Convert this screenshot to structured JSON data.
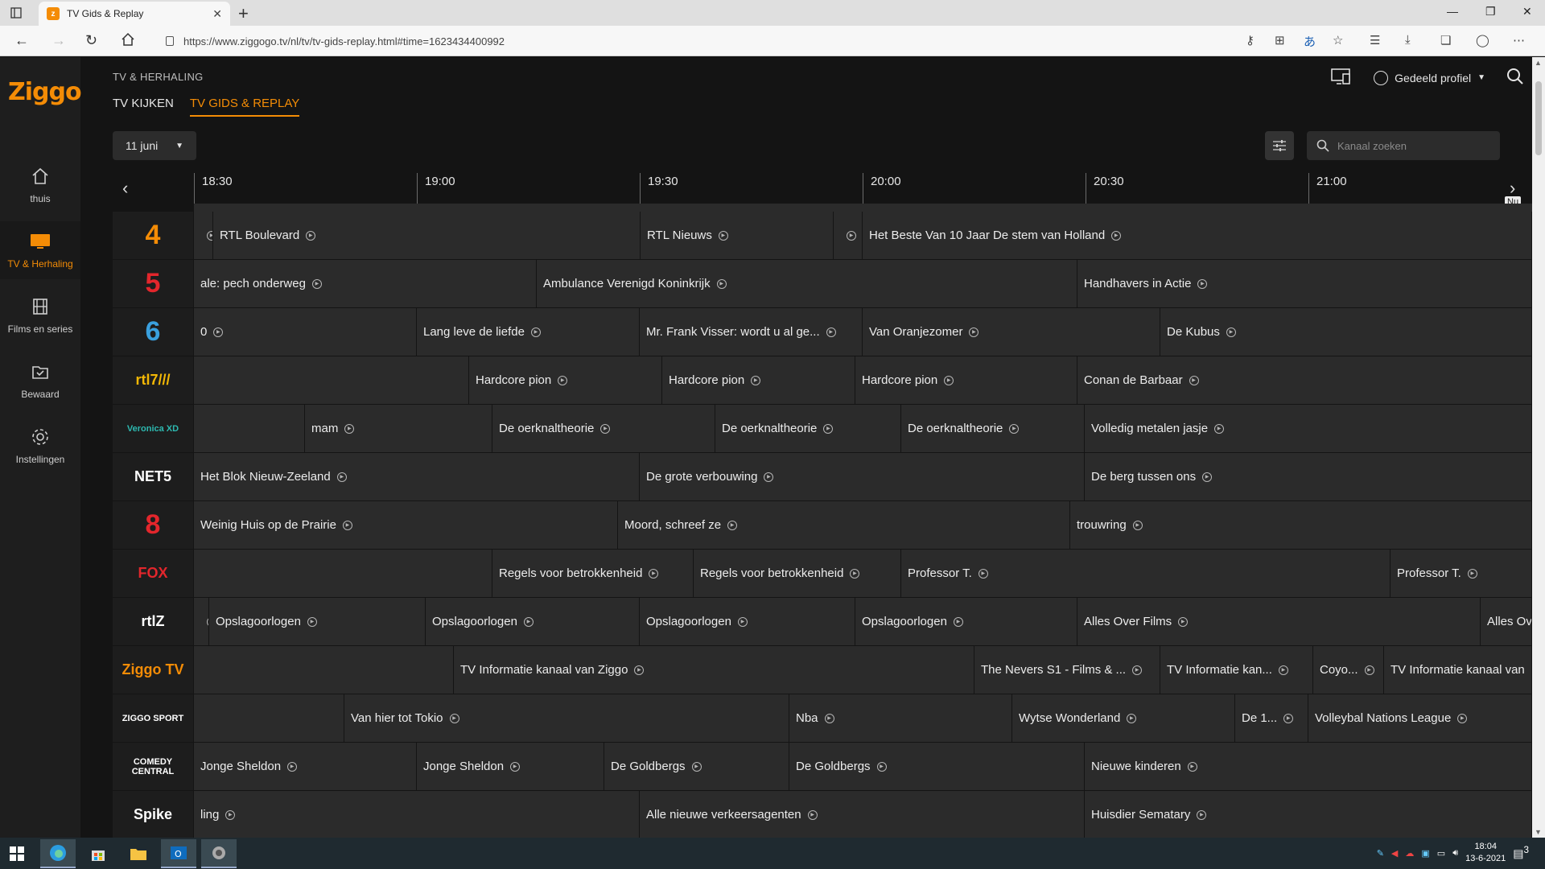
{
  "browser": {
    "tab_title": "TV Gids & Replay",
    "url": "https://www.ziggogo.tv/nl/tv/tv-gids-replay.html#time=1623434400992"
  },
  "sidebar": {
    "logo": "Ziggo",
    "items": [
      {
        "label": "thuis",
        "icon": "home-icon"
      },
      {
        "label": "TV & Herhaling",
        "icon": "tv-icon"
      },
      {
        "label": "Films en series",
        "icon": "film-icon"
      },
      {
        "label": "Bewaard",
        "icon": "saved-folder-icon"
      },
      {
        "label": "Instellingen",
        "icon": "settings-gear-icon"
      }
    ]
  },
  "header": {
    "breadcrumb": "TV & HERHALING",
    "tabs": [
      "TV KIJKEN",
      "TV GIDS & REPLAY"
    ],
    "profile": "Gedeeld profiel"
  },
  "controls": {
    "date": "11 juni",
    "search_placeholder": "Kanaal zoeken"
  },
  "timeline": {
    "times": [
      "18:30",
      "19:00",
      "19:30",
      "20:00",
      "20:30",
      "21:00"
    ],
    "now_label": "Nu"
  },
  "channels": [
    {
      "name": "RTL 4",
      "logo": "4",
      "color": "#f48c06",
      "programs": [
        {
          "t": ""
        },
        {
          "t": "RTL Boulevard"
        },
        {
          "t": "RTL Nieuws"
        },
        {
          "t": ""
        },
        {
          "t": "Het Beste Van 10 Jaar De stem van Holland"
        }
      ]
    },
    {
      "name": "RTL 5",
      "logo": "5",
      "color": "#e3262c",
      "programs": [
        {
          "t": "ale: pech onderweg"
        },
        {
          "t": "Ambulance Verenigd Koninkrijk"
        },
        {
          "t": "Handhavers in Actie"
        }
      ]
    },
    {
      "name": "SBS 6",
      "logo": "6",
      "color": "#3aa0de",
      "programs": [
        {
          "t": "0"
        },
        {
          "t": "Lang leve de liefde"
        },
        {
          "t": "Mr. Frank Visser: wordt u al ge..."
        },
        {
          "t": "Van Oranjezomer"
        },
        {
          "t": "De Kubus"
        }
      ]
    },
    {
      "name": "RTL 7",
      "logo": "rtl7///",
      "color": "#f2b705",
      "programs": [
        {
          "t": ""
        },
        {
          "t": "Hardcore pion"
        },
        {
          "t": "Hardcore pion"
        },
        {
          "t": "Hardcore pion"
        },
        {
          "t": "Conan de Barbaar"
        }
      ]
    },
    {
      "name": "Veronica XD",
      "logo": "Veronica XD",
      "color": "#2db9b0",
      "programs": [
        {
          "t": ""
        },
        {
          "t": "mam"
        },
        {
          "t": "De oerknaltheorie"
        },
        {
          "t": "De oerknaltheorie"
        },
        {
          "t": "De oerknaltheorie"
        },
        {
          "t": "Volledig metalen jasje"
        }
      ]
    },
    {
      "name": "NET5",
      "logo": "NET5",
      "color": "#ffffff",
      "programs": [
        {
          "t": "Het Blok Nieuw-Zeeland"
        },
        {
          "t": "De grote verbouwing"
        },
        {
          "t": "De berg tussen ons"
        }
      ]
    },
    {
      "name": "SBS 8",
      "logo": "8",
      "color": "#e3262c",
      "programs": [
        {
          "t": "Weinig Huis op de Prairie"
        },
        {
          "t": "Moord, schreef ze"
        },
        {
          "t": "trouwring"
        }
      ]
    },
    {
      "name": "FOX",
      "logo": "FOX",
      "color": "#e3262c",
      "programs": [
        {
          "t": ""
        },
        {
          "t": "Regels voor betrokkenheid"
        },
        {
          "t": "Regels voor betrokkenheid"
        },
        {
          "t": "Professor T."
        },
        {
          "t": "Professor T."
        }
      ]
    },
    {
      "name": "RTL Z",
      "logo": "rtlZ",
      "color": "#ffffff",
      "programs": [
        {
          "t": ""
        },
        {
          "t": "Opslagoorlogen"
        },
        {
          "t": "Opslagoorlogen"
        },
        {
          "t": "Opslagoorlogen"
        },
        {
          "t": "Opslagoorlogen"
        },
        {
          "t": "Alles Over Films"
        },
        {
          "t": "Alles Ov"
        }
      ]
    },
    {
      "name": "Ziggo TV",
      "logo": "Ziggo TV",
      "color": "#f48c06",
      "programs": [
        {
          "t": ""
        },
        {
          "t": "TV Informatie kanaal van Ziggo"
        },
        {
          "t": "The Nevers S1 - Films & ..."
        },
        {
          "t": "TV Informatie kan..."
        },
        {
          "t": "Coyo..."
        },
        {
          "t": "TV Informatie kanaal van"
        }
      ]
    },
    {
      "name": "Ziggo Sport",
      "logo": "ZIGGO SPORT",
      "color": "#ffffff",
      "programs": [
        {
          "t": ""
        },
        {
          "t": "Van hier tot Tokio"
        },
        {
          "t": "Nba"
        },
        {
          "t": "Wytse Wonderland"
        },
        {
          "t": "De 1..."
        },
        {
          "t": "Volleybal Nations League"
        }
      ]
    },
    {
      "name": "Comedy Central",
      "logo": "COMEDY CENTRAL",
      "color": "#ffffff",
      "programs": [
        {
          "t": "Jonge Sheldon"
        },
        {
          "t": "Jonge Sheldon"
        },
        {
          "t": "De Goldbergs"
        },
        {
          "t": "De Goldbergs"
        },
        {
          "t": "Nieuwe kinderen"
        }
      ]
    },
    {
      "name": "Spike",
      "logo": "Spike",
      "color": "#ffffff",
      "programs": [
        {
          "t": "ling"
        },
        {
          "t": "Alle nieuwe verkeersagenten"
        },
        {
          "t": "Huisdier Sematary"
        }
      ]
    }
  ],
  "taskbar": {
    "time": "18:04",
    "date": "13-6-2021",
    "notifications": "3"
  }
}
